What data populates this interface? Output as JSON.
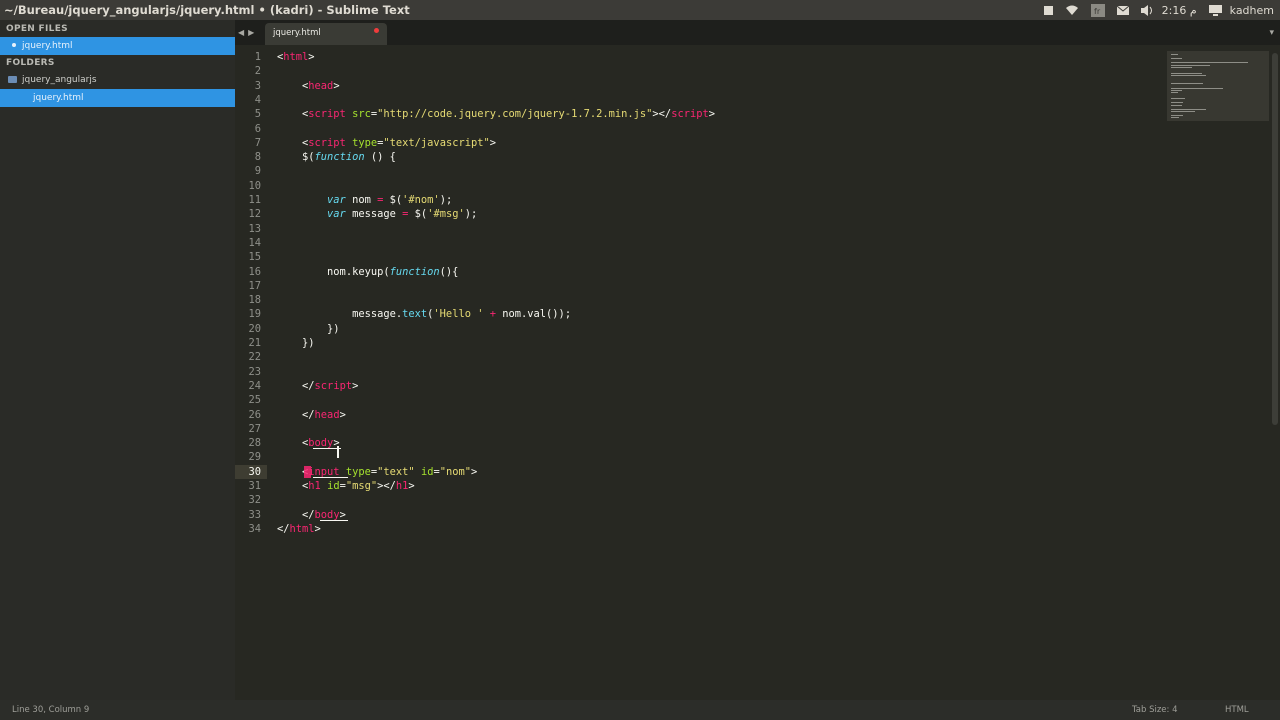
{
  "window": {
    "title": "~/Bureau/jquery_angularjs/jquery.html • (kadri) - Sublime Text"
  },
  "tray": {
    "time": "م 2:16",
    "user": "kadhem"
  },
  "sidebar": {
    "open_files_heading": "OPEN FILES",
    "open_files": [
      {
        "label": "jquery.html"
      }
    ],
    "folders_heading": "FOLDERS",
    "folders": [
      {
        "label": "jquery_angularjs",
        "children": [
          {
            "label": "jquery.html"
          }
        ]
      }
    ]
  },
  "tabs": [
    {
      "label": "jquery.html",
      "dirty": true
    }
  ],
  "editor": {
    "current_line": 30,
    "colors": {
      "background": "#272822",
      "tag": "#f92672",
      "attr": "#a6e22e",
      "string": "#e6db74",
      "keyword": "#66d9ef",
      "text": "#f8f8f2",
      "gutter": "#8f908a"
    },
    "lines": [
      [
        [
          "p",
          "<"
        ],
        [
          "t",
          "html"
        ],
        [
          "p",
          ">"
        ]
      ],
      [],
      [
        [
          "p",
          "    <"
        ],
        [
          "t",
          "head"
        ],
        [
          "p",
          ">"
        ]
      ],
      [],
      [
        [
          "p",
          "    <"
        ],
        [
          "t",
          "script"
        ],
        [
          "p",
          " "
        ],
        [
          "a",
          "src"
        ],
        [
          "p",
          "="
        ],
        [
          "s",
          "\"http://code.jquery.com/jquery-1.7.2.min.js\""
        ],
        [
          "p",
          "></"
        ],
        [
          "t",
          "script"
        ],
        [
          "p",
          ">"
        ]
      ],
      [],
      [
        [
          "p",
          "    <"
        ],
        [
          "t",
          "script"
        ],
        [
          "p",
          " "
        ],
        [
          "a",
          "type"
        ],
        [
          "p",
          "="
        ],
        [
          "s",
          "\"text/javascript\""
        ],
        [
          "p",
          ">"
        ]
      ],
      [
        [
          "p",
          "    $("
        ],
        [
          "k",
          "function"
        ],
        [
          "p",
          " () {"
        ]
      ],
      [],
      [],
      [
        [
          "p",
          "        "
        ],
        [
          "k",
          "var"
        ],
        [
          "p",
          " nom "
        ],
        [
          "o",
          "="
        ],
        [
          "p",
          " $("
        ],
        [
          "s",
          "'#nom'"
        ],
        [
          "p",
          ");"
        ]
      ],
      [
        [
          "p",
          "        "
        ],
        [
          "k",
          "var"
        ],
        [
          "p",
          " message "
        ],
        [
          "o",
          "="
        ],
        [
          "p",
          " $("
        ],
        [
          "s",
          "'#msg'"
        ],
        [
          "p",
          ");"
        ]
      ],
      [],
      [],
      [],
      [
        [
          "p",
          "        nom.keyup("
        ],
        [
          "k",
          "function"
        ],
        [
          "p",
          "(){"
        ]
      ],
      [],
      [],
      [
        [
          "p",
          "            message."
        ],
        [
          "k",
          "text"
        ],
        [
          "p",
          "("
        ],
        [
          "s",
          "'Hello '"
        ],
        [
          "p",
          " "
        ],
        [
          "o",
          "+"
        ],
        [
          "p",
          " nom.val());"
        ]
      ],
      [
        [
          "p",
          "        })"
        ]
      ],
      [
        [
          "p",
          "    })"
        ]
      ],
      [],
      [],
      [
        [
          "p",
          "    </"
        ],
        [
          "t",
          "script"
        ],
        [
          "p",
          ">"
        ]
      ],
      [],
      [
        [
          "p",
          "    </"
        ],
        [
          "t",
          "head"
        ],
        [
          "p",
          ">"
        ]
      ],
      [],
      [
        [
          "p",
          "    <"
        ],
        [
          "t",
          "body"
        ],
        [
          "p",
          ">"
        ]
      ],
      [],
      [
        [
          "p",
          "    <"
        ],
        [
          "t",
          "input"
        ],
        [
          "p",
          " "
        ],
        [
          "a",
          "type"
        ],
        [
          "p",
          "="
        ],
        [
          "s",
          "\"text\""
        ],
        [
          "p",
          " "
        ],
        [
          "a",
          "id"
        ],
        [
          "p",
          "="
        ],
        [
          "s",
          "\"nom\""
        ],
        [
          "p",
          ">"
        ]
      ],
      [
        [
          "p",
          "    <"
        ],
        [
          "t",
          "h1"
        ],
        [
          "p",
          " "
        ],
        [
          "a",
          "id"
        ],
        [
          "p",
          "="
        ],
        [
          "s",
          "\"msg\""
        ],
        [
          "p",
          "></"
        ],
        [
          "t",
          "h1"
        ],
        [
          "p",
          ">"
        ]
      ],
      [],
      [
        [
          "p",
          "    </"
        ],
        [
          "t",
          "body"
        ],
        [
          "p",
          ">"
        ]
      ],
      [
        [
          "p",
          "</"
        ],
        [
          "t",
          "html"
        ],
        [
          "p",
          ">"
        ]
      ]
    ]
  },
  "status": {
    "position": "Line 30, Column 9",
    "tab_size": "Tab Size: 4",
    "syntax": "HTML"
  }
}
